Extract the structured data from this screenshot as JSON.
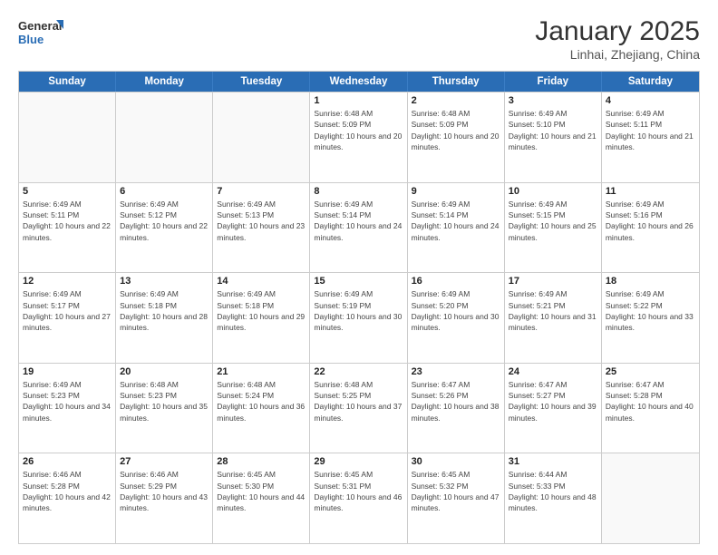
{
  "header": {
    "logo_general": "General",
    "logo_blue": "Blue",
    "month": "January 2025",
    "location": "Linhai, Zhejiang, China"
  },
  "days_of_week": [
    "Sunday",
    "Monday",
    "Tuesday",
    "Wednesday",
    "Thursday",
    "Friday",
    "Saturday"
  ],
  "weeks": [
    [
      {
        "day": "",
        "sunrise": "",
        "sunset": "",
        "daylight": "",
        "empty": true
      },
      {
        "day": "",
        "sunrise": "",
        "sunset": "",
        "daylight": "",
        "empty": true
      },
      {
        "day": "",
        "sunrise": "",
        "sunset": "",
        "daylight": "",
        "empty": true
      },
      {
        "day": "1",
        "sunrise": "Sunrise: 6:48 AM",
        "sunset": "Sunset: 5:09 PM",
        "daylight": "Daylight: 10 hours and 20 minutes.",
        "empty": false
      },
      {
        "day": "2",
        "sunrise": "Sunrise: 6:48 AM",
        "sunset": "Sunset: 5:09 PM",
        "daylight": "Daylight: 10 hours and 20 minutes.",
        "empty": false
      },
      {
        "day": "3",
        "sunrise": "Sunrise: 6:49 AM",
        "sunset": "Sunset: 5:10 PM",
        "daylight": "Daylight: 10 hours and 21 minutes.",
        "empty": false
      },
      {
        "day": "4",
        "sunrise": "Sunrise: 6:49 AM",
        "sunset": "Sunset: 5:11 PM",
        "daylight": "Daylight: 10 hours and 21 minutes.",
        "empty": false
      }
    ],
    [
      {
        "day": "5",
        "sunrise": "Sunrise: 6:49 AM",
        "sunset": "Sunset: 5:11 PM",
        "daylight": "Daylight: 10 hours and 22 minutes.",
        "empty": false
      },
      {
        "day": "6",
        "sunrise": "Sunrise: 6:49 AM",
        "sunset": "Sunset: 5:12 PM",
        "daylight": "Daylight: 10 hours and 22 minutes.",
        "empty": false
      },
      {
        "day": "7",
        "sunrise": "Sunrise: 6:49 AM",
        "sunset": "Sunset: 5:13 PM",
        "daylight": "Daylight: 10 hours and 23 minutes.",
        "empty": false
      },
      {
        "day": "8",
        "sunrise": "Sunrise: 6:49 AM",
        "sunset": "Sunset: 5:14 PM",
        "daylight": "Daylight: 10 hours and 24 minutes.",
        "empty": false
      },
      {
        "day": "9",
        "sunrise": "Sunrise: 6:49 AM",
        "sunset": "Sunset: 5:14 PM",
        "daylight": "Daylight: 10 hours and 24 minutes.",
        "empty": false
      },
      {
        "day": "10",
        "sunrise": "Sunrise: 6:49 AM",
        "sunset": "Sunset: 5:15 PM",
        "daylight": "Daylight: 10 hours and 25 minutes.",
        "empty": false
      },
      {
        "day": "11",
        "sunrise": "Sunrise: 6:49 AM",
        "sunset": "Sunset: 5:16 PM",
        "daylight": "Daylight: 10 hours and 26 minutes.",
        "empty": false
      }
    ],
    [
      {
        "day": "12",
        "sunrise": "Sunrise: 6:49 AM",
        "sunset": "Sunset: 5:17 PM",
        "daylight": "Daylight: 10 hours and 27 minutes.",
        "empty": false
      },
      {
        "day": "13",
        "sunrise": "Sunrise: 6:49 AM",
        "sunset": "Sunset: 5:18 PM",
        "daylight": "Daylight: 10 hours and 28 minutes.",
        "empty": false
      },
      {
        "day": "14",
        "sunrise": "Sunrise: 6:49 AM",
        "sunset": "Sunset: 5:18 PM",
        "daylight": "Daylight: 10 hours and 29 minutes.",
        "empty": false
      },
      {
        "day": "15",
        "sunrise": "Sunrise: 6:49 AM",
        "sunset": "Sunset: 5:19 PM",
        "daylight": "Daylight: 10 hours and 30 minutes.",
        "empty": false
      },
      {
        "day": "16",
        "sunrise": "Sunrise: 6:49 AM",
        "sunset": "Sunset: 5:20 PM",
        "daylight": "Daylight: 10 hours and 30 minutes.",
        "empty": false
      },
      {
        "day": "17",
        "sunrise": "Sunrise: 6:49 AM",
        "sunset": "Sunset: 5:21 PM",
        "daylight": "Daylight: 10 hours and 31 minutes.",
        "empty": false
      },
      {
        "day": "18",
        "sunrise": "Sunrise: 6:49 AM",
        "sunset": "Sunset: 5:22 PM",
        "daylight": "Daylight: 10 hours and 33 minutes.",
        "empty": false
      }
    ],
    [
      {
        "day": "19",
        "sunrise": "Sunrise: 6:49 AM",
        "sunset": "Sunset: 5:23 PM",
        "daylight": "Daylight: 10 hours and 34 minutes.",
        "empty": false
      },
      {
        "day": "20",
        "sunrise": "Sunrise: 6:48 AM",
        "sunset": "Sunset: 5:23 PM",
        "daylight": "Daylight: 10 hours and 35 minutes.",
        "empty": false
      },
      {
        "day": "21",
        "sunrise": "Sunrise: 6:48 AM",
        "sunset": "Sunset: 5:24 PM",
        "daylight": "Daylight: 10 hours and 36 minutes.",
        "empty": false
      },
      {
        "day": "22",
        "sunrise": "Sunrise: 6:48 AM",
        "sunset": "Sunset: 5:25 PM",
        "daylight": "Daylight: 10 hours and 37 minutes.",
        "empty": false
      },
      {
        "day": "23",
        "sunrise": "Sunrise: 6:47 AM",
        "sunset": "Sunset: 5:26 PM",
        "daylight": "Daylight: 10 hours and 38 minutes.",
        "empty": false
      },
      {
        "day": "24",
        "sunrise": "Sunrise: 6:47 AM",
        "sunset": "Sunset: 5:27 PM",
        "daylight": "Daylight: 10 hours and 39 minutes.",
        "empty": false
      },
      {
        "day": "25",
        "sunrise": "Sunrise: 6:47 AM",
        "sunset": "Sunset: 5:28 PM",
        "daylight": "Daylight: 10 hours and 40 minutes.",
        "empty": false
      }
    ],
    [
      {
        "day": "26",
        "sunrise": "Sunrise: 6:46 AM",
        "sunset": "Sunset: 5:28 PM",
        "daylight": "Daylight: 10 hours and 42 minutes.",
        "empty": false
      },
      {
        "day": "27",
        "sunrise": "Sunrise: 6:46 AM",
        "sunset": "Sunset: 5:29 PM",
        "daylight": "Daylight: 10 hours and 43 minutes.",
        "empty": false
      },
      {
        "day": "28",
        "sunrise": "Sunrise: 6:45 AM",
        "sunset": "Sunset: 5:30 PM",
        "daylight": "Daylight: 10 hours and 44 minutes.",
        "empty": false
      },
      {
        "day": "29",
        "sunrise": "Sunrise: 6:45 AM",
        "sunset": "Sunset: 5:31 PM",
        "daylight": "Daylight: 10 hours and 46 minutes.",
        "empty": false
      },
      {
        "day": "30",
        "sunrise": "Sunrise: 6:45 AM",
        "sunset": "Sunset: 5:32 PM",
        "daylight": "Daylight: 10 hours and 47 minutes.",
        "empty": false
      },
      {
        "day": "31",
        "sunrise": "Sunrise: 6:44 AM",
        "sunset": "Sunset: 5:33 PM",
        "daylight": "Daylight: 10 hours and 48 minutes.",
        "empty": false
      },
      {
        "day": "",
        "sunrise": "",
        "sunset": "",
        "daylight": "",
        "empty": true
      }
    ]
  ]
}
